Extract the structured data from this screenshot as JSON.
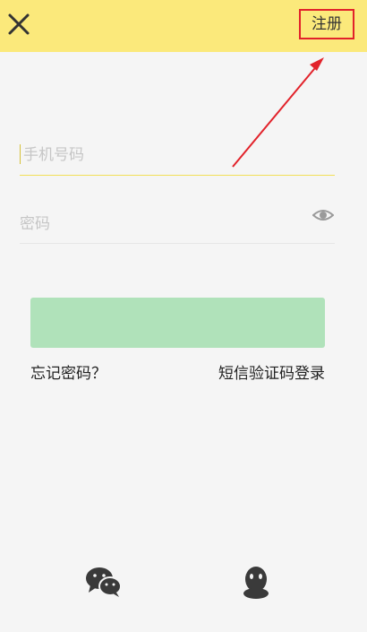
{
  "header": {
    "close_icon": "close-icon",
    "register_label": "注册"
  },
  "form": {
    "phone_placeholder": "手机号码",
    "password_placeholder": "密码",
    "eye_icon": "eye-icon"
  },
  "actions": {
    "login_label": "",
    "forgot_password": "忘记密码？",
    "sms_login": "短信验证码登录"
  },
  "social": {
    "wechat_icon": "wechat-icon",
    "qq_icon": "qq-icon"
  },
  "colors": {
    "header_bg": "#fbe97b",
    "login_button": "#a9e0b4",
    "annotation_red": "#e2222a"
  }
}
